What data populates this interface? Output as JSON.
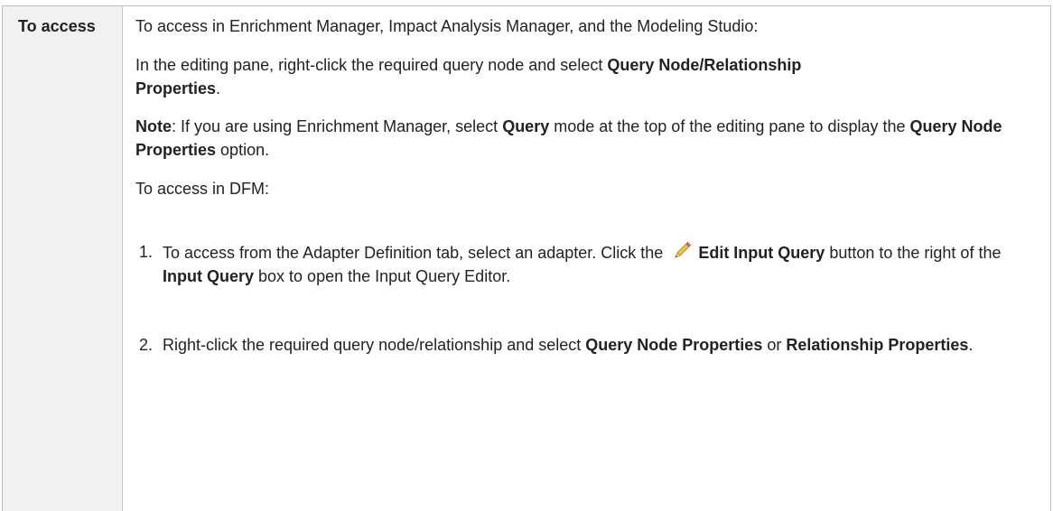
{
  "label": "To access",
  "intro": "To access in Enrichment Manager, Impact Analysis Manager, and the Modeling Studio:",
  "step_pane": {
    "prefix": "In the editing pane, right-click the required query node and select ",
    "bold": "Query Node/Relationship Properties",
    "suffix": "."
  },
  "note": {
    "label": "Note",
    "text1": ": If you are using Enrichment Manager, select ",
    "bold1": "Query",
    "text2": " mode at the top of the editing pane to display the ",
    "bold2": "Query Node Properties",
    "text3": " option."
  },
  "dfm_intro": "To access in DFM:",
  "list": [
    {
      "num": "1.",
      "t1": "To access from the Adapter Definition tab, select an adapter. Click the ",
      "icon": "pencil-edit-icon",
      "b1": "Edit Input Query",
      "t2": " button to the right of the ",
      "b2": "Input Query",
      "t3": " box to open the Input Query Editor."
    },
    {
      "num": "2.",
      "t1": "Right-click the required query node/relationship and select ",
      "b1": "Query Node Properties",
      "t2": " or ",
      "b2": "Relationship Properties",
      "t3": "."
    }
  ]
}
